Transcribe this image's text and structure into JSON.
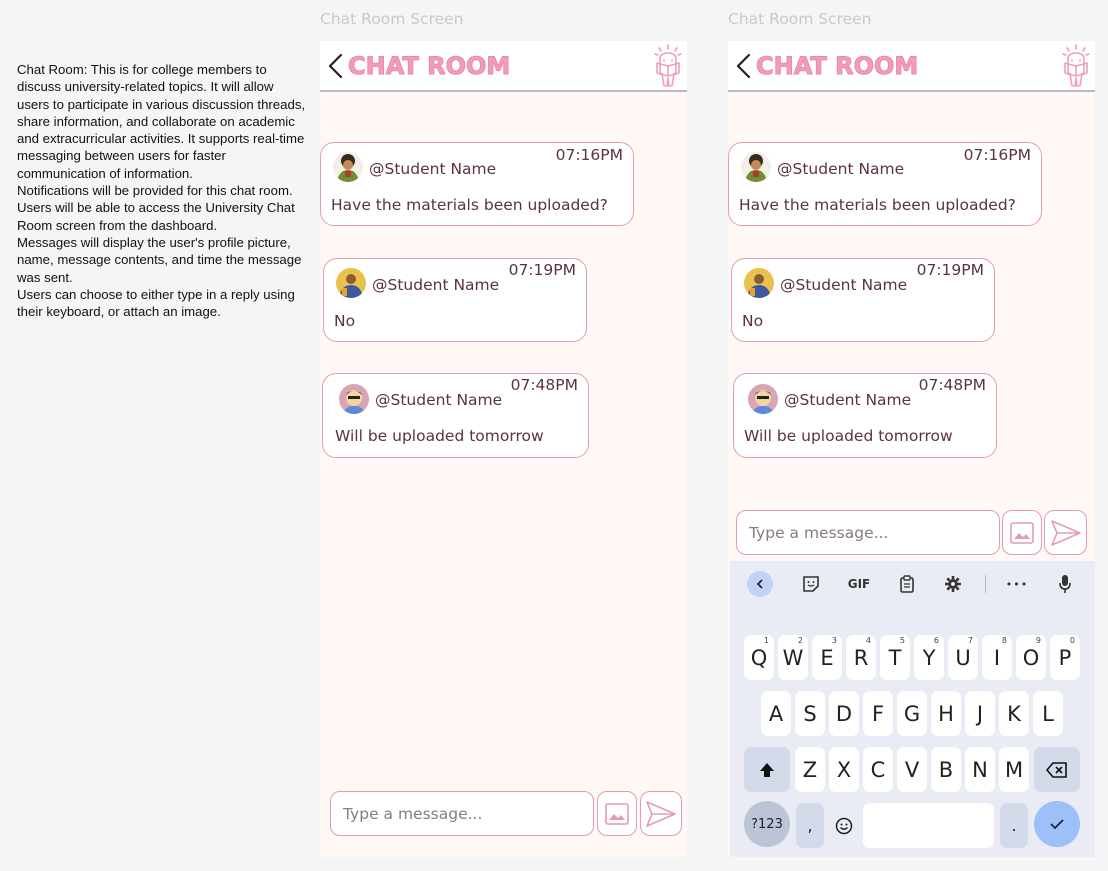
{
  "description": "Chat Room: This is for college members to discuss university-related topics. It will allow users to participate in various discussion threads, share information, and collaborate on academic and extracurricular activities. It supports real-time messaging between users for faster communication of information.\nNotifications will be provided for this chat room.\nUsers will be able to access the University Chat Room screen from the dashboard.\nMessages will display the user's profile picture, name, message contents, and time the message was sent.\nUsers can choose to either type in a reply using their keyboard, or attach an image.",
  "frames": [
    {
      "label": "Chat Room Screen",
      "header": {
        "title": "CHAT ROOM",
        "back_icon": "chevron-left-icon",
        "logo_icon": "mascot-logo-icon"
      },
      "messages": [
        {
          "name": "@Student Name",
          "time": "07:16PM",
          "text": "Have the materials been uploaded?"
        },
        {
          "name": "@Student Name",
          "time": "07:19PM",
          "text": "No"
        },
        {
          "name": "@Student Name",
          "time": "07:48PM",
          "text": "Will be uploaded tomorrow"
        }
      ],
      "composer": {
        "placeholder": "Type a message...",
        "image_icon": "image-icon",
        "send_icon": "send-icon"
      }
    },
    {
      "label": "Chat Room Screen",
      "header": {
        "title": "CHAT ROOM",
        "back_icon": "chevron-left-icon",
        "logo_icon": "mascot-logo-icon"
      },
      "messages": [
        {
          "name": "@Student Name",
          "time": "07:16PM",
          "text": "Have the materials been uploaded?"
        },
        {
          "name": "@Student Name",
          "time": "07:19PM",
          "text": "No"
        },
        {
          "name": "@Student Name",
          "time": "07:48PM",
          "text": "Will be uploaded tomorrow"
        }
      ],
      "composer": {
        "placeholder": "Type a message...",
        "image_icon": "image-icon",
        "send_icon": "send-icon"
      }
    }
  ],
  "keyboard": {
    "toolbar": {
      "gif": "GIF",
      "more": "•••"
    },
    "row1": [
      "Q",
      "W",
      "E",
      "R",
      "T",
      "Y",
      "U",
      "I",
      "O",
      "P"
    ],
    "row1_nums": [
      "1",
      "2",
      "3",
      "4",
      "5",
      "6",
      "7",
      "8",
      "9",
      "0"
    ],
    "row2": [
      "A",
      "S",
      "D",
      "F",
      "G",
      "H",
      "J",
      "K",
      "L"
    ],
    "row3": [
      "Z",
      "X",
      "C",
      "V",
      "B",
      "N",
      "M"
    ],
    "symbols": "?123",
    "comma": ",",
    "period": "."
  },
  "colors": {
    "accent": "#f29cba",
    "border": "#e59bb6",
    "text": "#5b3340",
    "background": "#fff8f4",
    "enter": "#9cc0f7"
  }
}
